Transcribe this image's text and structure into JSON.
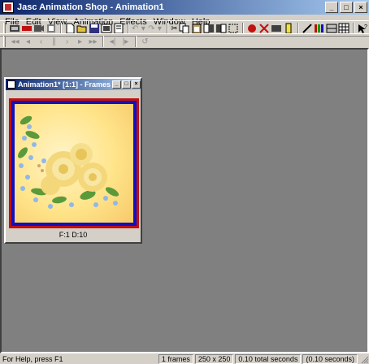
{
  "app": {
    "title": "Jasc Animation Shop - Animation1",
    "window_buttons": [
      "_",
      "□",
      "×"
    ]
  },
  "menu": [
    "File",
    "Edit",
    "View",
    "Animation",
    "Effects",
    "Window",
    "Help"
  ],
  "toolbar_icons": [
    "animation-wizard-icon",
    "banner-wizard-icon",
    "video-icon",
    "optimization-wizard-icon",
    "new-icon",
    "open-icon",
    "save-icon",
    "view-animation-icon",
    "properties-icon",
    "undo-icon",
    "redo-icon",
    "cut-icon",
    "copy-icon",
    "paste-new-icon",
    "paste-before-icon",
    "paste-after-icon",
    "select-all-icon",
    "effects-icon",
    "transition-icon",
    "text-effect-icon",
    "frame-props-icon",
    "palette-icon",
    "color-bars-icon",
    "replace-icon",
    "help-icon"
  ],
  "playback_icons": [
    "first-frame-icon",
    "prev-frame-icon",
    "prev-icon",
    "pause-icon",
    "next-icon",
    "next-frame-icon",
    "last-frame-icon",
    "loop-icon"
  ],
  "document": {
    "title": "Animation1* [1:1] - Frames",
    "frame_label": "F:1   D:10"
  },
  "status": {
    "help": "For Help, press F1",
    "frames": "1 frames",
    "size": "250 x 250",
    "total": "0.10 total seconds",
    "range": "(0.10 seconds)"
  }
}
